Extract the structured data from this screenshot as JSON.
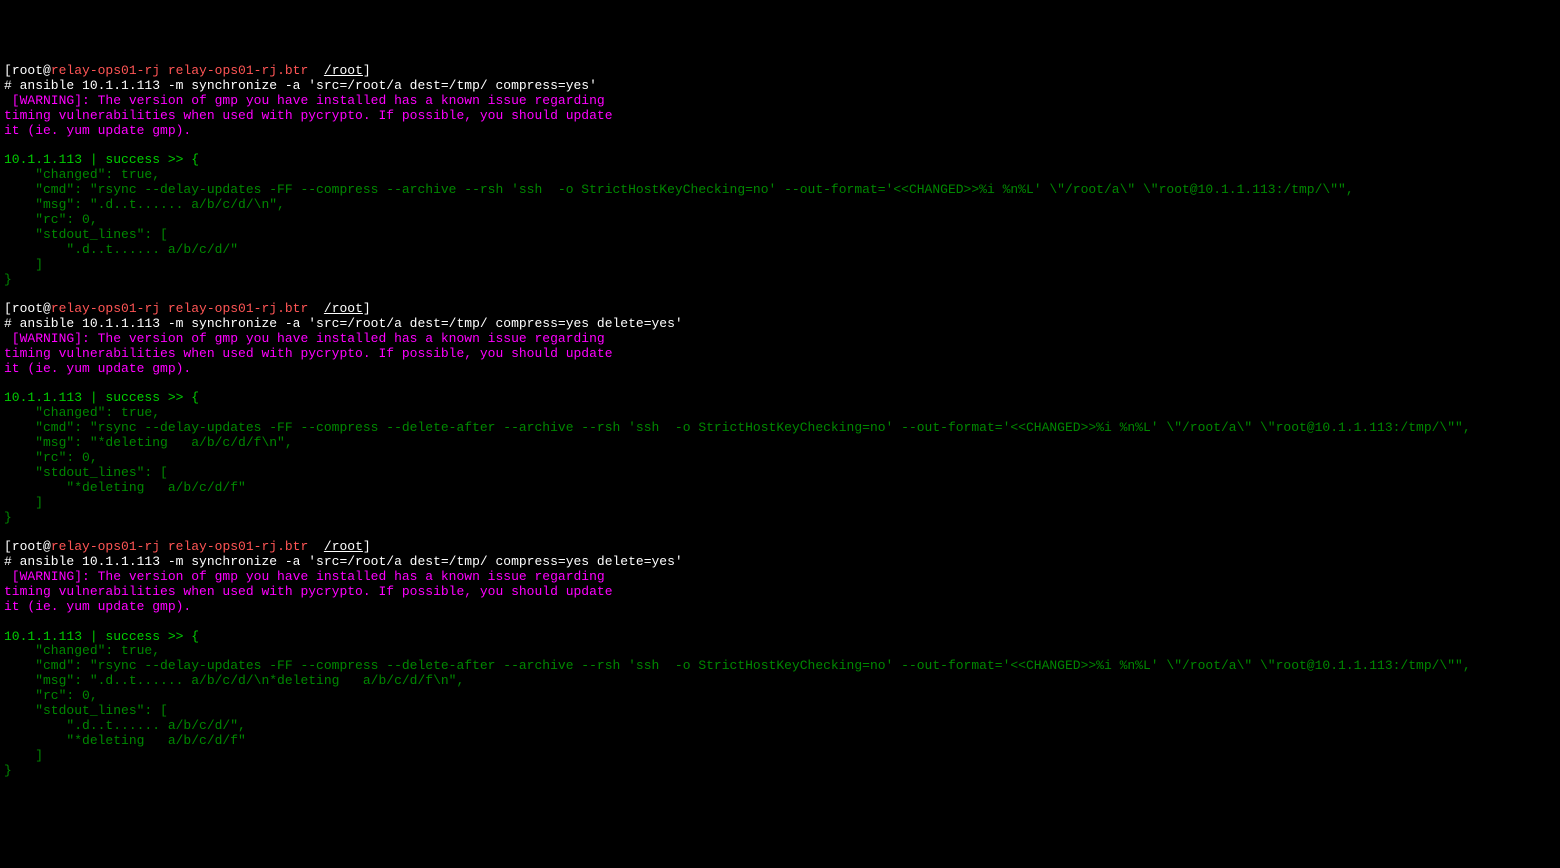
{
  "blocks": [
    {
      "prompt": {
        "lbracket": "[",
        "userhost": "root@",
        "host": "relay-ops01-rj relay-ops01-rj.btr",
        "sep": "  ",
        "path": "/root",
        "rbracket": "]"
      },
      "cmd": "# ansible 10.1.1.113 -m synchronize -a 'src=/root/a dest=/tmp/ compress=yes'",
      "warning": [
        " [WARNING]: The version of gmp you have installed has a known issue regarding",
        "timing vulnerabilities when used with pycrypto. If possible, you should update",
        "it (ie. yum update gmp)."
      ],
      "success": "10.1.1.113 | success >> {",
      "json": [
        "    \"changed\": true,",
        "    \"cmd\": \"rsync --delay-updates -FF --compress --archive --rsh 'ssh  -o StrictHostKeyChecking=no' --out-format='<<CHANGED>>%i %n%L' \\\"/root/a\\\" \\\"root@10.1.1.113:/tmp/\\\"\",",
        "    \"msg\": \".d..t...... a/b/c/d/\\n\",",
        "    \"rc\": 0,",
        "    \"stdout_lines\": [",
        "        \".d..t...... a/b/c/d/\"",
        "    ]",
        "}"
      ]
    },
    {
      "prompt": {
        "lbracket": "[",
        "userhost": "root@",
        "host": "relay-ops01-rj relay-ops01-rj.btr",
        "sep": "  ",
        "path": "/root",
        "rbracket": "]"
      },
      "cmd": "# ansible 10.1.1.113 -m synchronize -a 'src=/root/a dest=/tmp/ compress=yes delete=yes'",
      "warning": [
        " [WARNING]: The version of gmp you have installed has a known issue regarding",
        "timing vulnerabilities when used with pycrypto. If possible, you should update",
        "it (ie. yum update gmp)."
      ],
      "success": "10.1.1.113 | success >> {",
      "json": [
        "    \"changed\": true,",
        "    \"cmd\": \"rsync --delay-updates -FF --compress --delete-after --archive --rsh 'ssh  -o StrictHostKeyChecking=no' --out-format='<<CHANGED>>%i %n%L' \\\"/root/a\\\" \\\"root@10.1.1.113:/tmp/\\\"\",",
        "    \"msg\": \"*deleting   a/b/c/d/f\\n\",",
        "    \"rc\": 0,",
        "    \"stdout_lines\": [",
        "        \"*deleting   a/b/c/d/f\"",
        "    ]",
        "}"
      ]
    },
    {
      "prompt": {
        "lbracket": "[",
        "userhost": "root@",
        "host": "relay-ops01-rj relay-ops01-rj.btr",
        "sep": "  ",
        "path": "/root",
        "rbracket": "]"
      },
      "cmd": "# ansible 10.1.1.113 -m synchronize -a 'src=/root/a dest=/tmp/ compress=yes delete=yes'",
      "warning": [
        " [WARNING]: The version of gmp you have installed has a known issue regarding",
        "timing vulnerabilities when used with pycrypto. If possible, you should update",
        "it (ie. yum update gmp)."
      ],
      "success": "10.1.1.113 | success >> {",
      "json": [
        "    \"changed\": true,",
        "    \"cmd\": \"rsync --delay-updates -FF --compress --delete-after --archive --rsh 'ssh  -o StrictHostKeyChecking=no' --out-format='<<CHANGED>>%i %n%L' \\\"/root/a\\\" \\\"root@10.1.1.113:/tmp/\\\"\",",
        "    \"msg\": \".d..t...... a/b/c/d/\\n*deleting   a/b/c/d/f\\n\",",
        "    \"rc\": 0,",
        "    \"stdout_lines\": [",
        "        \".d..t...... a/b/c/d/\",",
        "        \"*deleting   a/b/c/d/f\"",
        "    ]",
        "}"
      ]
    }
  ]
}
